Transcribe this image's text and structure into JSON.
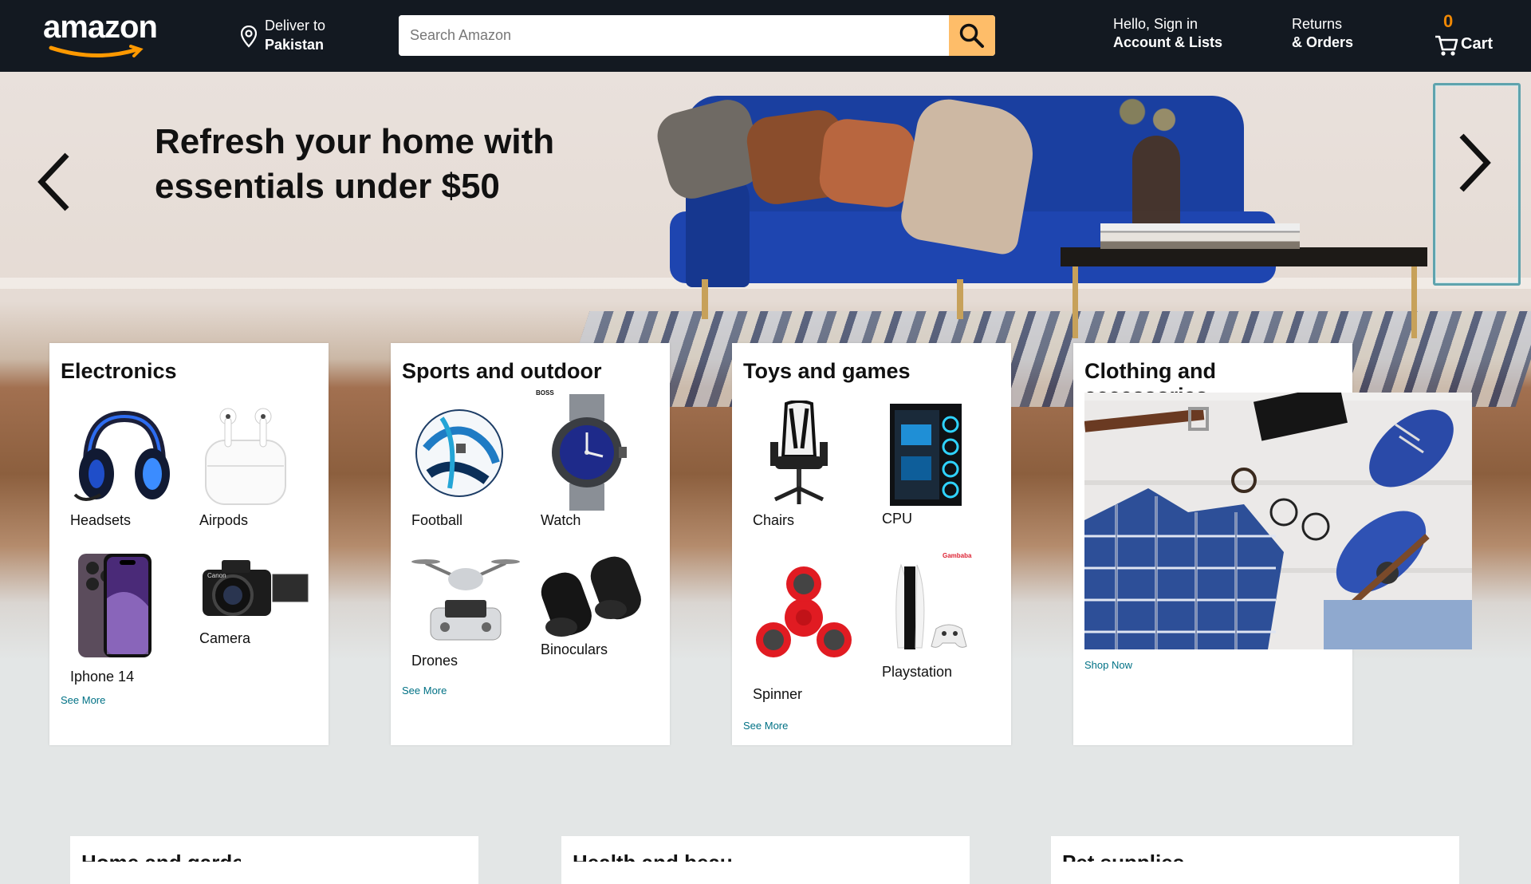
{
  "header": {
    "logo_text": "amazon",
    "deliver_line1": "Deliver to",
    "deliver_line2": "Pakistan",
    "search_placeholder": "Search Amazon",
    "account_line1": "Hello, Sign in",
    "account_line2": "Account & Lists",
    "returns_line1": "Returns",
    "returns_line2": "& Orders",
    "cart_count": "0",
    "cart_label": "Cart",
    "colors": {
      "navbar": "#131921",
      "search_button": "#febd69",
      "cart_count": "#f08804"
    }
  },
  "hero": {
    "title_line1": "Refresh your home with",
    "title_line2": "essentials under $50",
    "prev_icon": "chevron-left-icon",
    "next_icon": "chevron-right-icon"
  },
  "cards": [
    {
      "title": "Electronics",
      "items": [
        {
          "label": "Headsets",
          "icon": "headset-icon"
        },
        {
          "label": "Airpods",
          "icon": "airpods-icon"
        },
        {
          "label": "Iphone 14",
          "icon": "phone-icon"
        },
        {
          "label": "Camera",
          "icon": "camera-icon"
        }
      ],
      "link": "See More"
    },
    {
      "title": "Sports and outdoor",
      "items": [
        {
          "label": "Football",
          "icon": "football-icon"
        },
        {
          "label": "Watch",
          "icon": "watch-icon"
        },
        {
          "label": "Drones",
          "icon": "drone-icon"
        },
        {
          "label": "Binoculars",
          "icon": "binoculars-icon"
        }
      ],
      "watch_brand": "BOSS",
      "link": "See More"
    },
    {
      "title": "Toys and games",
      "items": [
        {
          "label": "Chairs",
          "icon": "chair-icon"
        },
        {
          "label": "CPU",
          "icon": "cpu-icon"
        },
        {
          "label": "Spinner",
          "icon": "spinner-icon"
        },
        {
          "label": "Playstation",
          "icon": "playstation-icon"
        }
      ],
      "playstation_brand": "Gambaba",
      "link": "See More"
    },
    {
      "title": "Clothing and accessories",
      "image": "clothing-accessories-image",
      "link": "Shop Now"
    }
  ],
  "bottom_cards": [
    {
      "title": "Home and garden"
    },
    {
      "title": "Health and beauty"
    },
    {
      "title": "Pet supplies"
    }
  ]
}
